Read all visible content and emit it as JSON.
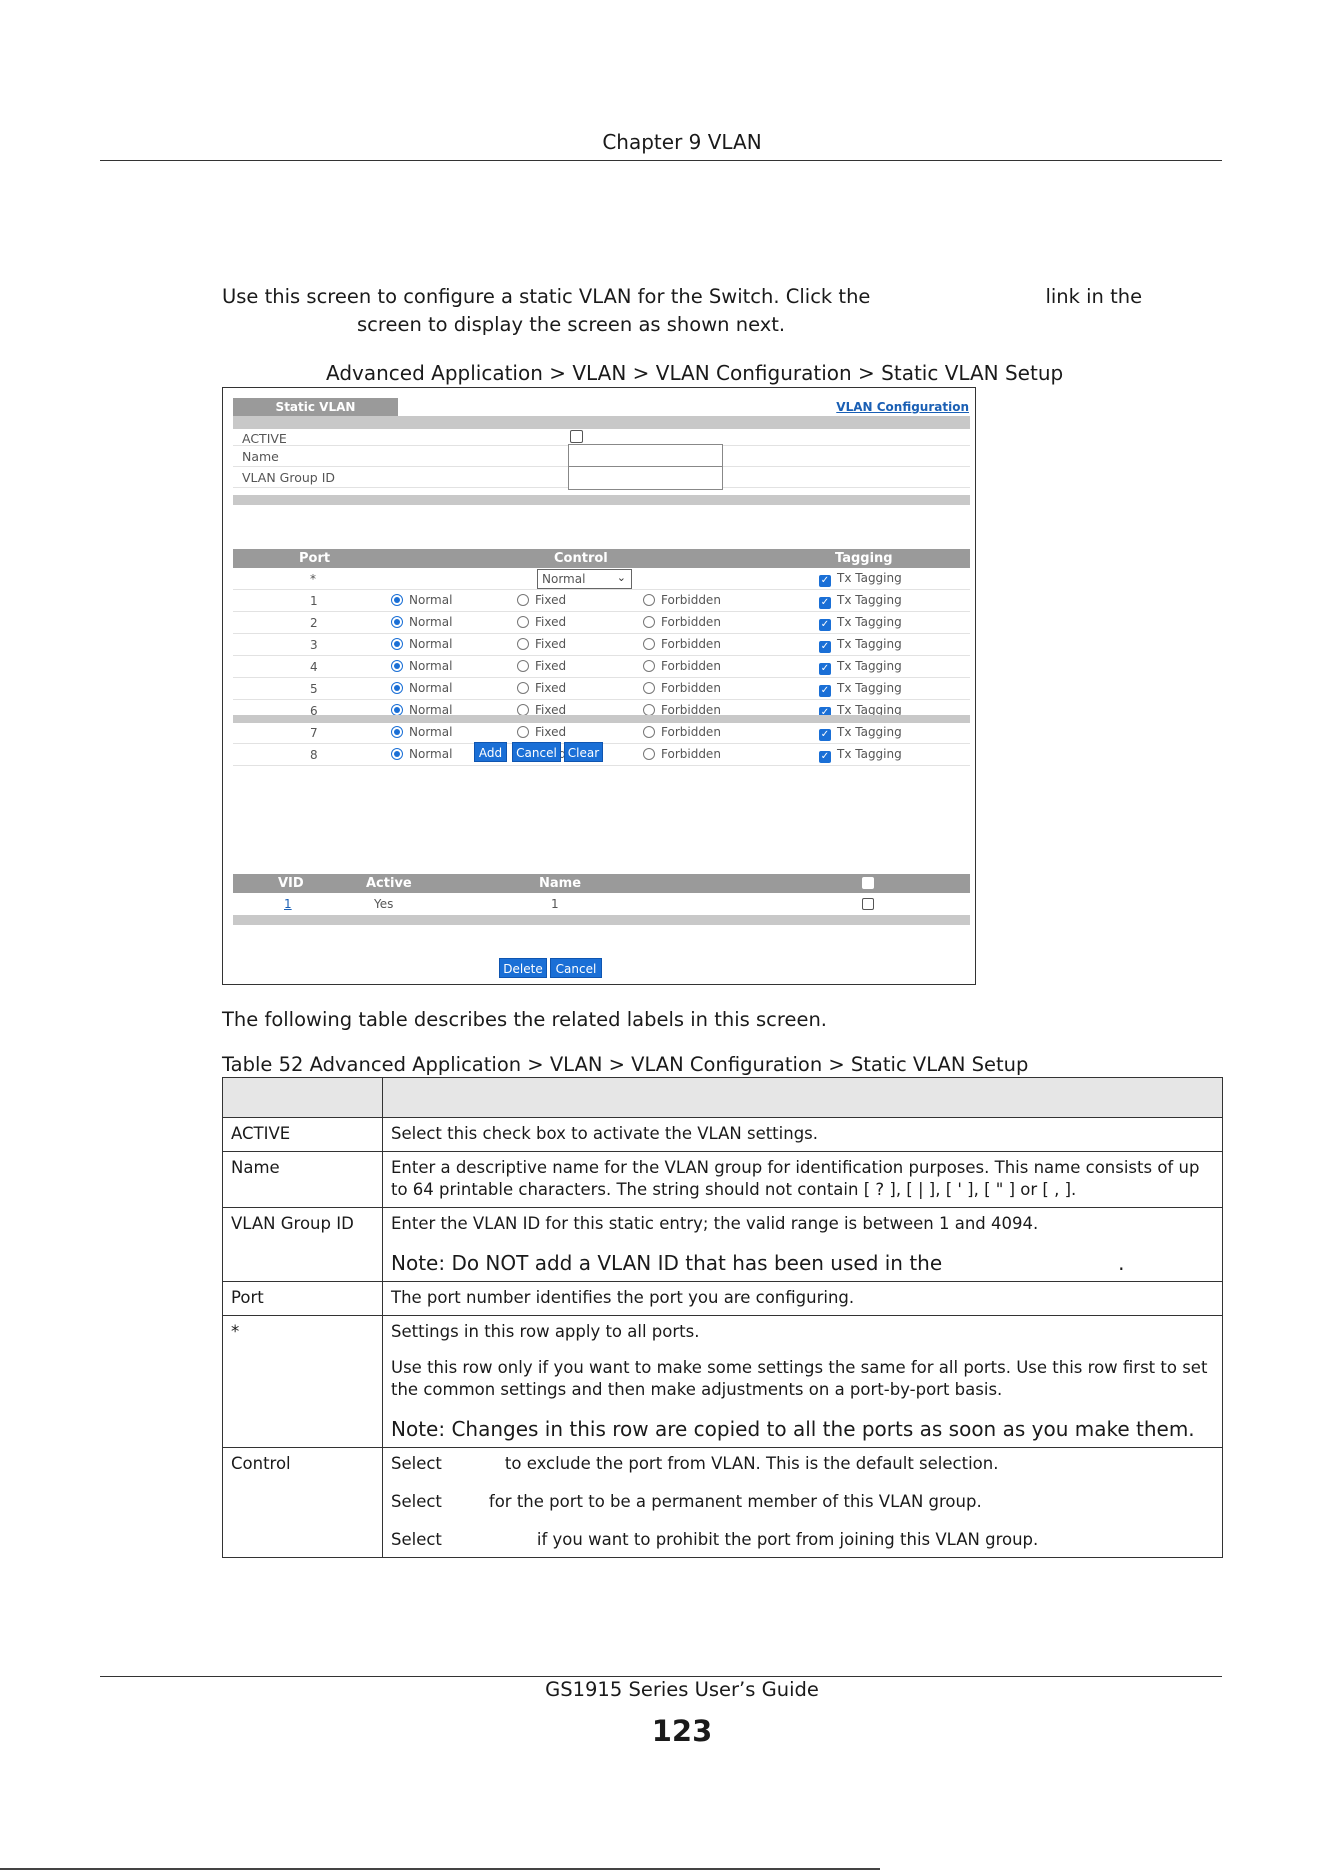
{
  "header": {
    "chapter": "Chapter 9 VLAN"
  },
  "intro": {
    "part1": "Use this screen to configure a static VLAN for the Switch. Click the",
    "part2": "link in the",
    "part3": "screen to display the screen as shown next."
  },
  "figure": {
    "caption": "Advanced Application > VLAN > VLAN Configuration > Static VLAN Setup",
    "tab_label": "Static VLAN",
    "link_label": "VLAN Configuration",
    "fields": {
      "active": "ACTIVE",
      "name": "Name",
      "group_id": "VLAN Group ID"
    },
    "port_table": {
      "headers": {
        "port": "Port",
        "control": "Control",
        "tagging": "Tagging"
      },
      "all_row": {
        "port": "*",
        "select_value": "Normal",
        "tagging": "Tx Tagging"
      },
      "rows": [
        {
          "port": "1",
          "normal": "Normal",
          "fixed": "Fixed",
          "forbidden": "Forbidden",
          "tagging": "Tx Tagging"
        },
        {
          "port": "2",
          "normal": "Normal",
          "fixed": "Fixed",
          "forbidden": "Forbidden",
          "tagging": "Tx Tagging"
        },
        {
          "port": "3",
          "normal": "Normal",
          "fixed": "Fixed",
          "forbidden": "Forbidden",
          "tagging": "Tx Tagging"
        },
        {
          "port": "4",
          "normal": "Normal",
          "fixed": "Fixed",
          "forbidden": "Forbidden",
          "tagging": "Tx Tagging"
        },
        {
          "port": "5",
          "normal": "Normal",
          "fixed": "Fixed",
          "forbidden": "Forbidden",
          "tagging": "Tx Tagging"
        },
        {
          "port": "6",
          "normal": "Normal",
          "fixed": "Fixed",
          "forbidden": "Forbidden",
          "tagging": "Tx Tagging"
        },
        {
          "port": "7",
          "normal": "Normal",
          "fixed": "Fixed",
          "forbidden": "Forbidden",
          "tagging": "Tx Tagging"
        },
        {
          "port": "8",
          "normal": "Normal",
          "fixed": "Fixed",
          "forbidden": "Forbidden",
          "tagging": "Tx Tagging"
        }
      ]
    },
    "buttons": {
      "add": "Add",
      "cancel": "Cancel",
      "clear": "Clear",
      "delete": "Delete",
      "cancel2": "Cancel"
    },
    "vlan_list": {
      "headers": {
        "vid": "VID",
        "active": "Active",
        "name": "Name"
      },
      "rows": [
        {
          "vid": "1",
          "active": "Yes",
          "name": "1"
        }
      ]
    }
  },
  "after_text": "The following table describes the related labels in this screen.",
  "table": {
    "caption": "Table 52   Advanced Application > VLAN > VLAN Configuration > Static VLAN Setup",
    "rows": {
      "active": {
        "label": "ACTIVE",
        "desc": "Select this check box to activate the VLAN settings."
      },
      "name": {
        "label": "Name",
        "desc": "Enter a descriptive name for the VLAN group for identification purposes. This name consists of up to 64 printable characters. The string should not contain [ ? ], [ | ], [ ' ], [ \" ] or [ , ]."
      },
      "group_id": {
        "label": "VLAN Group ID",
        "desc": "Enter the VLAN ID for this static entry; the valid range is between 1 and 4094.",
        "note": "Note: Do NOT add a VLAN ID that has been used in the",
        "note_end": "."
      },
      "port": {
        "label": "Port",
        "desc": "The port number identifies the port you are configuring."
      },
      "star": {
        "label": "*",
        "desc1": "Settings in this row apply to all ports.",
        "desc2": "Use this row only if you want to make some settings the same for all ports. Use this row first to set the common settings and then make adjustments on a port-by-port basis.",
        "note": "Note: Changes in this row are copied to all the ports as soon as you make them."
      },
      "control": {
        "label": "Control",
        "line1a": "Select",
        "line1b": "to exclude the port from VLAN. This is the default selection.",
        "line2a": "Select",
        "line2b": "for the port to be a permanent member of this VLAN group.",
        "line3a": "Select",
        "line3b": "if you want to prohibit the port from joining this VLAN group."
      }
    }
  },
  "footer": {
    "guide": "GS1915 Series User’s Guide",
    "page": "123"
  }
}
